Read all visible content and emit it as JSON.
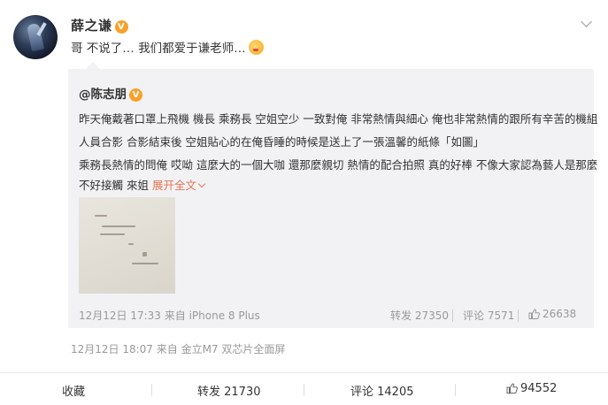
{
  "post": {
    "username": "薛之谦",
    "text": "哥 不说了… 我们都爱于谦老师…",
    "verified_badge": "V",
    "meta": "12月12日 18:07 来自 金立M7 双芯片全面屏"
  },
  "repost": {
    "username": "@陈志朋",
    "verified_badge": "V",
    "lines": [
      "昨天俺戴著口罩上飛機 機長 乘務長 空姐空少 一致對俺 非常熱情與細心 俺也非常熱情的跟所有辛苦的機組",
      "人員合影 合影結束後 空姐貼心的在俺昏睡的時候是送上了一張溫馨的紙條「如圖」",
      "乘務長熱情的問俺 哎呦 這麼大的一個大咖 還那麼親切 熱情的配合拍照 真的好棒 不像大家認為藝人是那麼",
      "不好接觸 來姐"
    ],
    "expand_label": "展开全文",
    "time": "12月12日 17:33 来自 iPhone 8 Plus",
    "repost_count": "转发 27350",
    "comment_count": "评论 7571",
    "like_count": "26638"
  },
  "actions": {
    "favorite": "收藏",
    "repost": "转发 21730",
    "comment": "评论 14205",
    "like": "94552"
  },
  "colors": {
    "link": "#eb7350",
    "badge": "#f9a02a",
    "repost_bg": "#f2f2f5"
  }
}
